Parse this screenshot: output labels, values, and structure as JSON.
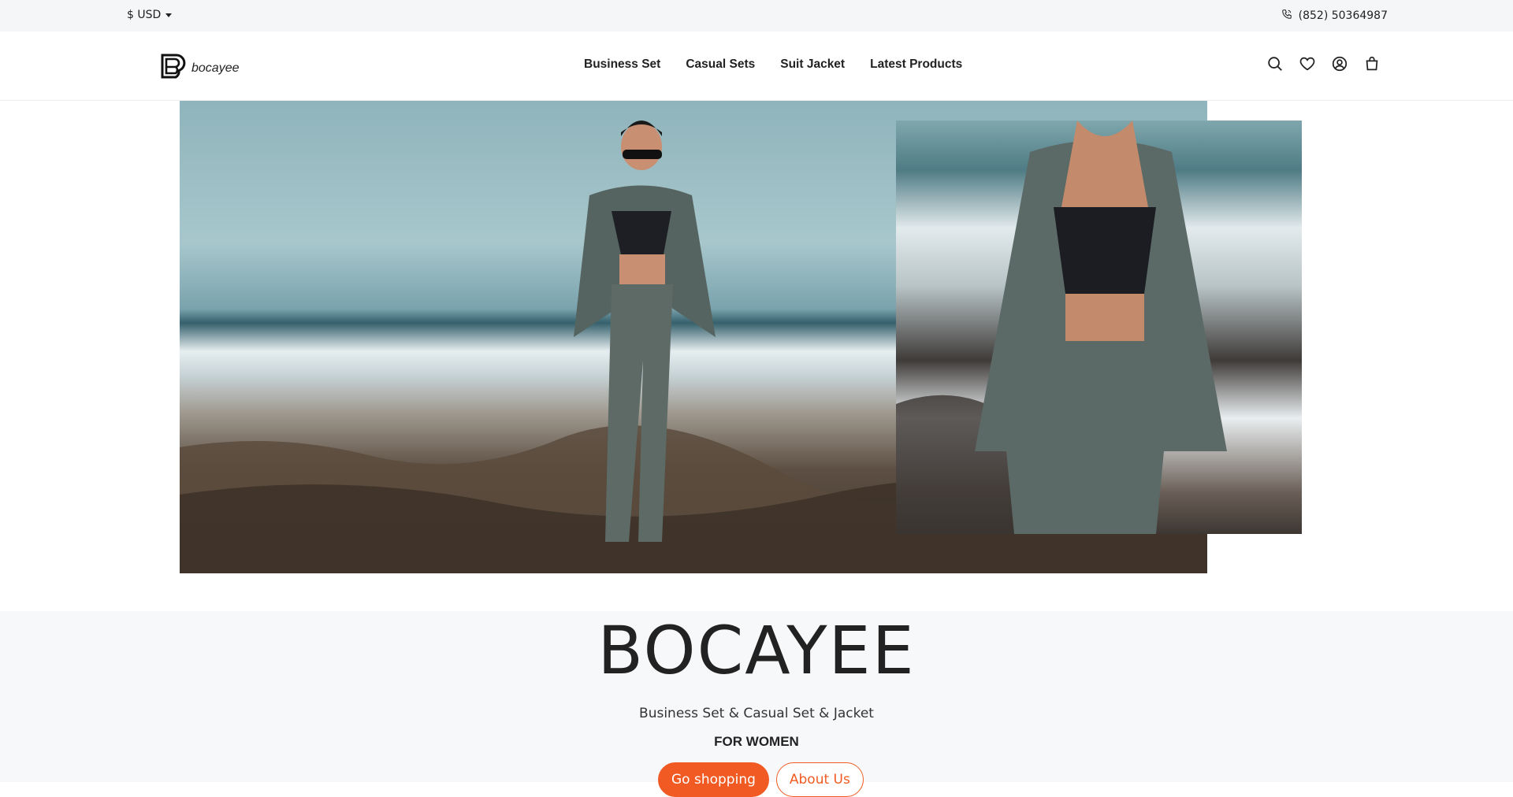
{
  "topbar": {
    "currency": "$ USD",
    "phone": "(852) 50364987"
  },
  "header": {
    "logo_text": "bocayee",
    "nav": [
      "Business Set",
      "Casual Sets",
      "Suit Jacket",
      "Latest Products"
    ],
    "icons": [
      "search-icon",
      "heart-icon",
      "account-icon",
      "bag-icon"
    ]
  },
  "hero": {
    "images": [
      "woman-grey-suit-beach",
      "woman-grey-suit-closeup"
    ]
  },
  "brand": {
    "title": "BOCAYEE",
    "subtitle": "Business Set & Casual Set & Jacket",
    "tagline": "FOR WOMEN",
    "primary_button": "Go shopping",
    "secondary_button": "About Us"
  },
  "colors": {
    "accent": "#f15a22",
    "topbar_bg": "#f5f6f8",
    "section_bg": "#f7f8fa"
  }
}
